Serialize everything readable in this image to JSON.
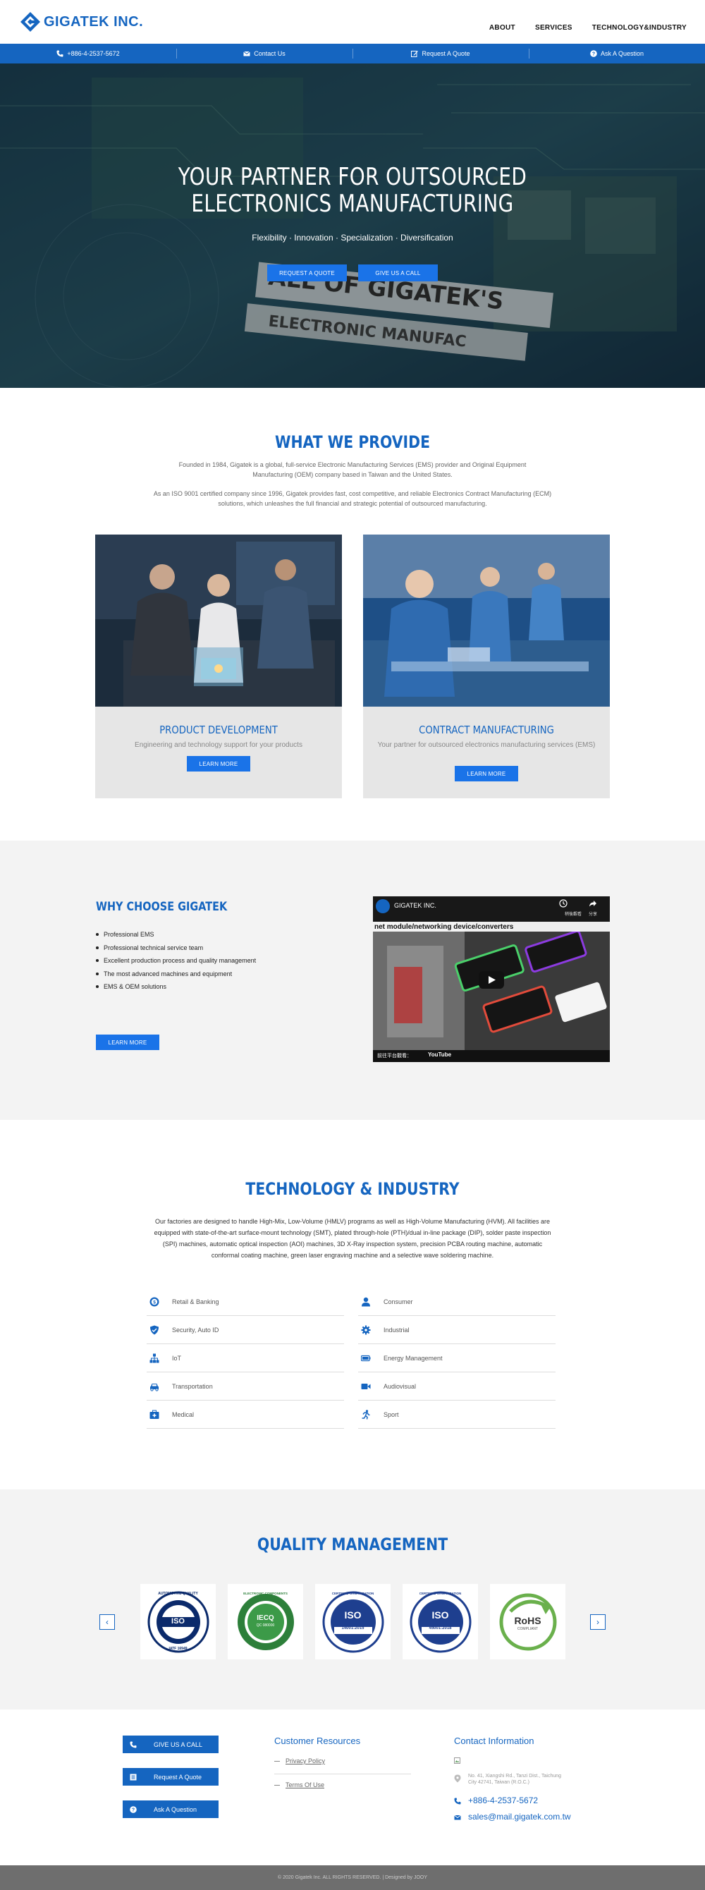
{
  "header": {
    "logo_text": "GIGATEK INC.",
    "nav": [
      "ABOUT",
      "SERVICES",
      "TECHNOLOGY&INDUSTRY"
    ]
  },
  "topbar": {
    "phone": "+886-4-2537-5672",
    "contact": "Contact Us",
    "quote": "Request A Quote",
    "ask": "Ask A Question"
  },
  "hero": {
    "title_line1": "YOUR PARTNER FOR OUTSOURCED",
    "title_line2": "ELECTRONICS MANUFACTURING",
    "subtitle": "Flexibility · Innovation · Specialization · Diversification",
    "btn_quote": "REQUEST A QUOTE",
    "btn_call": "GIVE US A CALL",
    "board_text1": "ALL OF GIGATEK'S",
    "board_text2": "ELECTRONIC MANUFAC"
  },
  "provide": {
    "title": "WHAT WE PROVIDE",
    "para1": "Founded in 1984, Gigatek is a global, full-service Electronic Manufacturing Services (EMS) provider and Original Equipment Manufacturing (OEM) company based in Taiwan and the United States.",
    "para2": "As an ISO 9001 certified company since 1996, Gigatek provides fast, cost competitive, and reliable Electronics Contract Manufacturing (ECM) solutions, which unleashes the full financial and strategic potential of outsourced manufacturing.",
    "cards": [
      {
        "title": "PRODUCT DEVELOPMENT",
        "subtitle": "Engineering and technology support for your products",
        "button": "LEARN MORE"
      },
      {
        "title": "CONTRACT MANUFACTURING",
        "subtitle": "Your partner for outsourced electronics manufacturing services (EMS)",
        "button": "LEARN MORE"
      }
    ]
  },
  "why": {
    "title": "WHY CHOOSE GIGATEK",
    "items": [
      "Professional EMS",
      "Professional technical service team",
      "Excellent production process and quality management",
      "The most advanced machines and equipment",
      "EMS & OEM solutions"
    ],
    "button": "LEARN MORE",
    "video": {
      "channel": "GIGATEK INC.",
      "headline": "net module/networking device/converters",
      "watch_later": "稍後觀看",
      "share": "分享",
      "watch_on": "前往平台觀看：",
      "youtube": "YouTube"
    }
  },
  "tech": {
    "title": "TECHNOLOGY & INDUSTRY",
    "para": "Our factories are designed to handle High-Mix, Low-Volume (HMLV) programs as well as High-Volume Manufacturing (HVM). All facilities are equipped with state-of-the-art surface-mount technology (SMT), plated through-hole (PTH)/dual in-line package (DIP), solder paste inspection (SPI) machines, automatic optical inspection (AOI) machines, 3D X-Ray inspection system, precision PCBA routing machine, automatic conformal coating machine, green laser engraving machine and a selective wave soldering machine.",
    "left": [
      {
        "label": "Retail & Banking",
        "icon": "coin-icon"
      },
      {
        "label": "Security, Auto ID",
        "icon": "shield-icon"
      },
      {
        "label": "IoT",
        "icon": "network-icon"
      },
      {
        "label": "Transportation",
        "icon": "car-icon"
      },
      {
        "label": "Medical",
        "icon": "medkit-icon"
      }
    ],
    "right": [
      {
        "label": "Consumer",
        "icon": "user-icon"
      },
      {
        "label": "Industrial",
        "icon": "gear-icon"
      },
      {
        "label": "Energy Management",
        "icon": "battery-icon"
      },
      {
        "label": "Audiovisual",
        "icon": "video-camera-icon"
      },
      {
        "label": "Sport",
        "icon": "running-icon"
      }
    ]
  },
  "quality": {
    "title": "QUALITY MANAGEMENT",
    "certs": [
      {
        "name": "ISO",
        "ring": "AUTOMOTIVE QUALITY",
        "code": "IATF 16949"
      },
      {
        "name": "IECQ",
        "ring": "ELECTRONIC COMPONENTS",
        "code": "QC 080000"
      },
      {
        "name": "ISO",
        "ring": "CERTIFIED ORGANIZATION",
        "code": "14001:2015"
      },
      {
        "name": "ISO",
        "ring": "CERTIFIED ORGANIZATION",
        "code": "45001:2018"
      },
      {
        "name": "RoHS",
        "ring": "COMPLIANT",
        "code": "COMPLIANT"
      }
    ],
    "prev": "‹",
    "next": "›"
  },
  "footer": {
    "btn_call": "GIVE US A CALL",
    "btn_quote": "Request A Quote",
    "btn_ask": "Ask A Question",
    "resources_title": "Customer Resources",
    "resources": [
      "Privacy Policy",
      "Terms Of Use"
    ],
    "contact_title": "Contact Information",
    "address": "No. 41, Xiangshi Rd., Tanzi Dist., Taichung City 42741, Taiwan (R.O.C.)",
    "phone": "+886-4-2537-5672",
    "email": "sales@mail.gigatek.com.tw",
    "copyright": "© 2020 Gigatek Inc. ALL RIGHTS RESERVED.   |   Designed by JOOY"
  },
  "colors": {
    "brand": "#1565c0",
    "button": "#1a73e8",
    "section_bg": "#f3f3f3",
    "footer_bar": "#6e6e6e"
  }
}
